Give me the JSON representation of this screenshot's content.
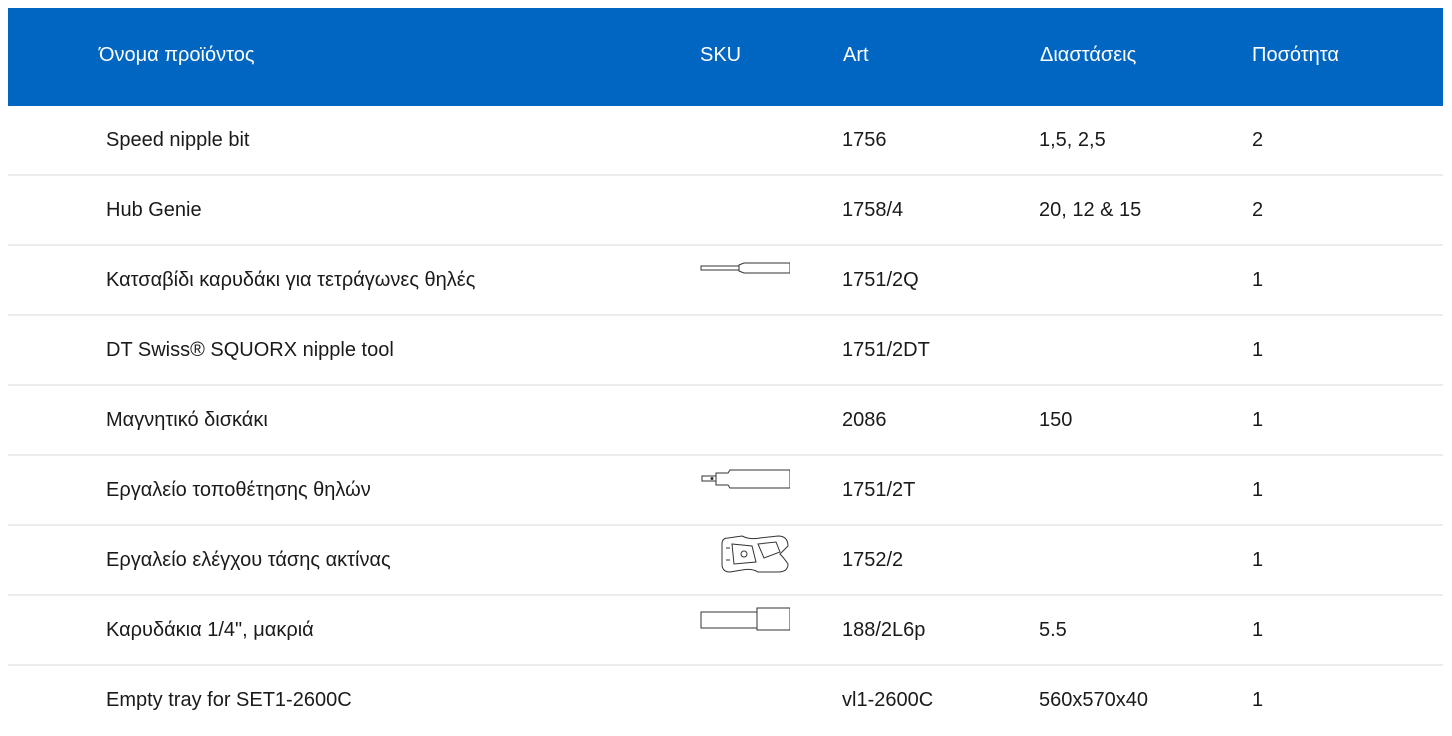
{
  "table": {
    "headers": {
      "name": "Όνομα προϊόντος",
      "sku": "SKU",
      "art": "Art",
      "dimensions": "Διαστάσεις",
      "quantity": "Ποσότητα"
    },
    "rows": [
      {
        "name": "Speed nipple bit",
        "sku_image": "",
        "art": "1756",
        "dimensions": "1,5, 2,5",
        "quantity": "2"
      },
      {
        "name": "Hub Genie",
        "sku_image": "",
        "art": "1758/4",
        "dimensions": "20, 12 & 15",
        "quantity": "2"
      },
      {
        "name": "Κατσαβίδι καρυδάκι για τετράγωνες θηλές",
        "sku_image": "screwdriver-thumbnail",
        "art": "1751/2Q",
        "dimensions": "",
        "quantity": "1"
      },
      {
        "name": "DT Swiss® SQUORX nipple tool",
        "sku_image": "",
        "art": "1751/2DT",
        "dimensions": "",
        "quantity": "1"
      },
      {
        "name": "Μαγνητικό δισκάκι",
        "sku_image": "",
        "art": "2086",
        "dimensions": "150",
        "quantity": "1"
      },
      {
        "name": "Εργαλείο τοποθέτησης θηλών",
        "sku_image": "nipple-driver-thumbnail",
        "art": "1751/2T",
        "dimensions": "",
        "quantity": "1"
      },
      {
        "name": "Εργαλείο ελέγχου τάσης ακτίνας",
        "sku_image": "tension-meter-thumbnail",
        "art": "1752/2",
        "dimensions": "",
        "quantity": "1"
      },
      {
        "name": "Καρυδάκια 1/4\", μακριά",
        "sku_image": "socket-thumbnail",
        "art": "188/2L6p",
        "dimensions": "5.5",
        "quantity": "1"
      },
      {
        "name": "Empty tray for SET1-2600C",
        "sku_image": "",
        "art": "vl1-2600C",
        "dimensions": "560x570x40",
        "quantity": "1"
      }
    ]
  },
  "colors": {
    "header_bg": "#0066c2",
    "header_text": "#ffffff",
    "row_divider": "#ececec",
    "body_text": "#1a1a1a"
  }
}
